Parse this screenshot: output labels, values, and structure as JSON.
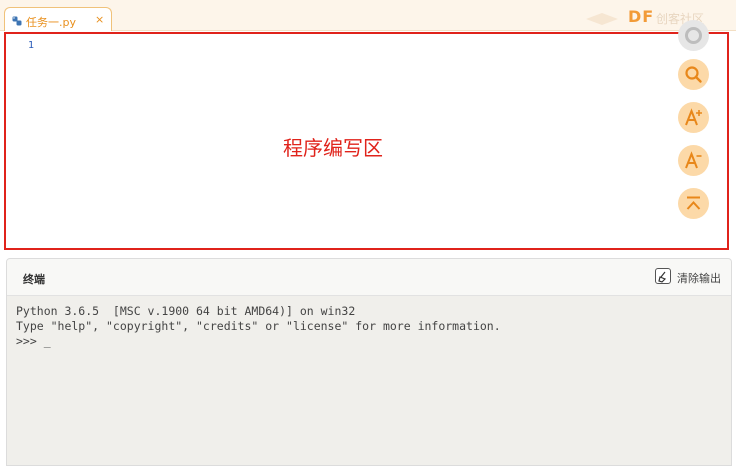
{
  "tab": {
    "label": "任务一.py",
    "close": "×",
    "icon": "python-icon"
  },
  "branding": {
    "logo": "DF",
    "text": "创客社区"
  },
  "editor": {
    "line_numbers": [
      "1"
    ],
    "caption": "程序编写区",
    "accent_color": "#e0231b",
    "tools": [
      {
        "name": "settings-icon"
      },
      {
        "name": "search-icon"
      },
      {
        "name": "font-increase-icon"
      },
      {
        "name": "font-decrease-icon"
      },
      {
        "name": "collapse-up-icon"
      }
    ]
  },
  "terminal": {
    "title": "终端",
    "clear_label": "清除输出",
    "lines": [
      "Python 3.6.5  [MSC v.1900 64 bit AMD64)] on win32",
      "Type \"help\", \"copyright\", \"credits\" or \"license\" for more information.",
      ">>> _"
    ]
  },
  "colors": {
    "brand_orange": "#f29b38",
    "button_bg": "#fcd9a8",
    "icon_orange": "#e8871a"
  }
}
